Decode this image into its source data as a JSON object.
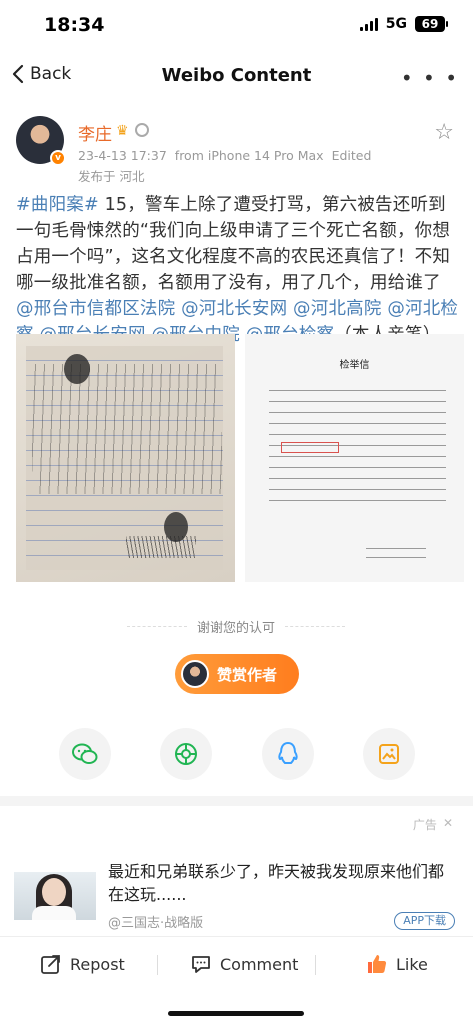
{
  "status_bar": {
    "time": "18:34",
    "network": "5G",
    "battery": "69"
  },
  "nav": {
    "back_label": "Back",
    "title": "Weibo Content",
    "more": "• • •"
  },
  "author": {
    "name": "李庄",
    "date": "23-4-13 17:37",
    "source": "from iPhone 14 Pro Max",
    "edited": "Edited",
    "location": "发布于 河北"
  },
  "post": {
    "hashtag": "#曲阳案#",
    "body": " 15，警车上除了遭受打骂，第六被告还听到一句毛骨悚然的“我们向上级申请了三个死亡名额，你想占用一个吗”，这名文化程度不高的农民还真信了！不知哪一级批准名额，名额用了没有，用了几个，用给谁了",
    "mentions": [
      "@邢台市信都区法院",
      "@河北长安网",
      "@河北高院",
      "@河北检察",
      "@邢台长安网",
      "@邢台中院",
      "@邢台检察"
    ],
    "tail": "（本人亲笔）"
  },
  "document": {
    "title": "检举信"
  },
  "appreciation": {
    "text": "谢谢您的认可",
    "reward_label": "赞赏作者"
  },
  "ad": {
    "tag": "广告",
    "text": "最近和兄弟联系少了，昨天被我发现原来他们都在这玩......",
    "source": "@三国志·战略版",
    "download_label": "APP下载"
  },
  "actions": {
    "repost": "Repost",
    "comment": "Comment",
    "like": "Like"
  },
  "colors": {
    "accent_orange": "#ff8200",
    "link_blue": "#4a7fb5",
    "author_name": "#e86a2a"
  }
}
